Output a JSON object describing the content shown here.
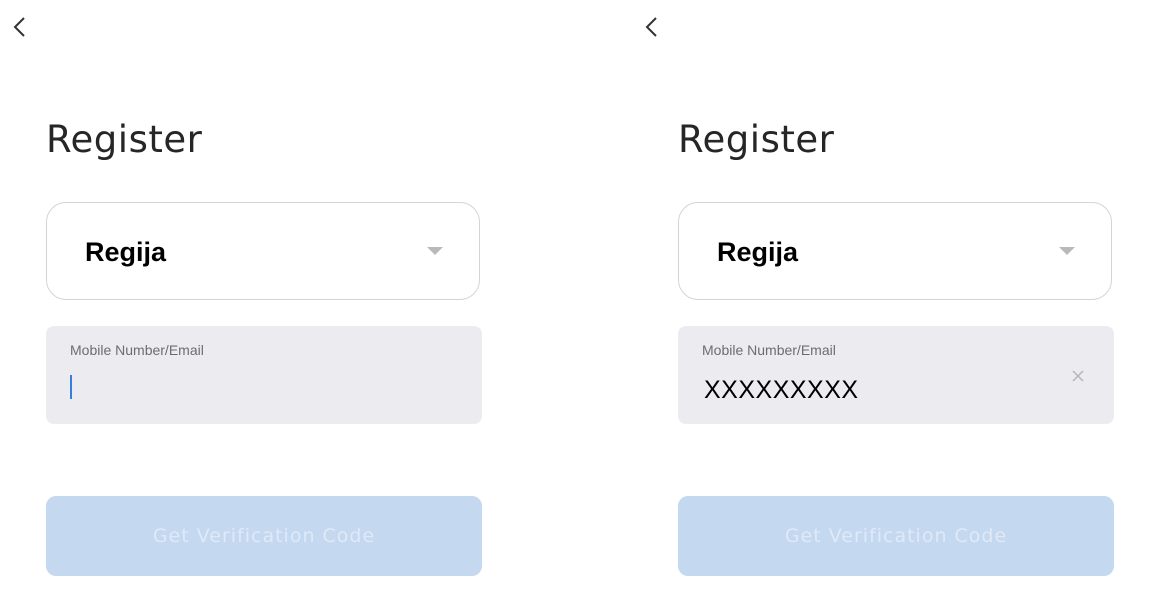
{
  "screens": [
    {
      "title": "Register",
      "region": {
        "label": "Regija"
      },
      "contact": {
        "label": "Mobile Number/Email",
        "value": ""
      },
      "button": {
        "label": "Get Verification Code"
      }
    },
    {
      "title": "Register",
      "region": {
        "label": "Regija"
      },
      "contact": {
        "label": "Mobile Number/Email",
        "value": "XXXXXXXXX"
      },
      "button": {
        "label": "Get Verification Code"
      }
    }
  ],
  "icons": [
    "back-arrow-icon",
    "dropdown-caret-icon",
    "clear-icon",
    "text-cursor"
  ],
  "colors": {
    "title_text": "#262626",
    "input_background": "#ececf0",
    "button_disabled": "#c4d8f0",
    "cursor_accent": "#3a7de0"
  }
}
